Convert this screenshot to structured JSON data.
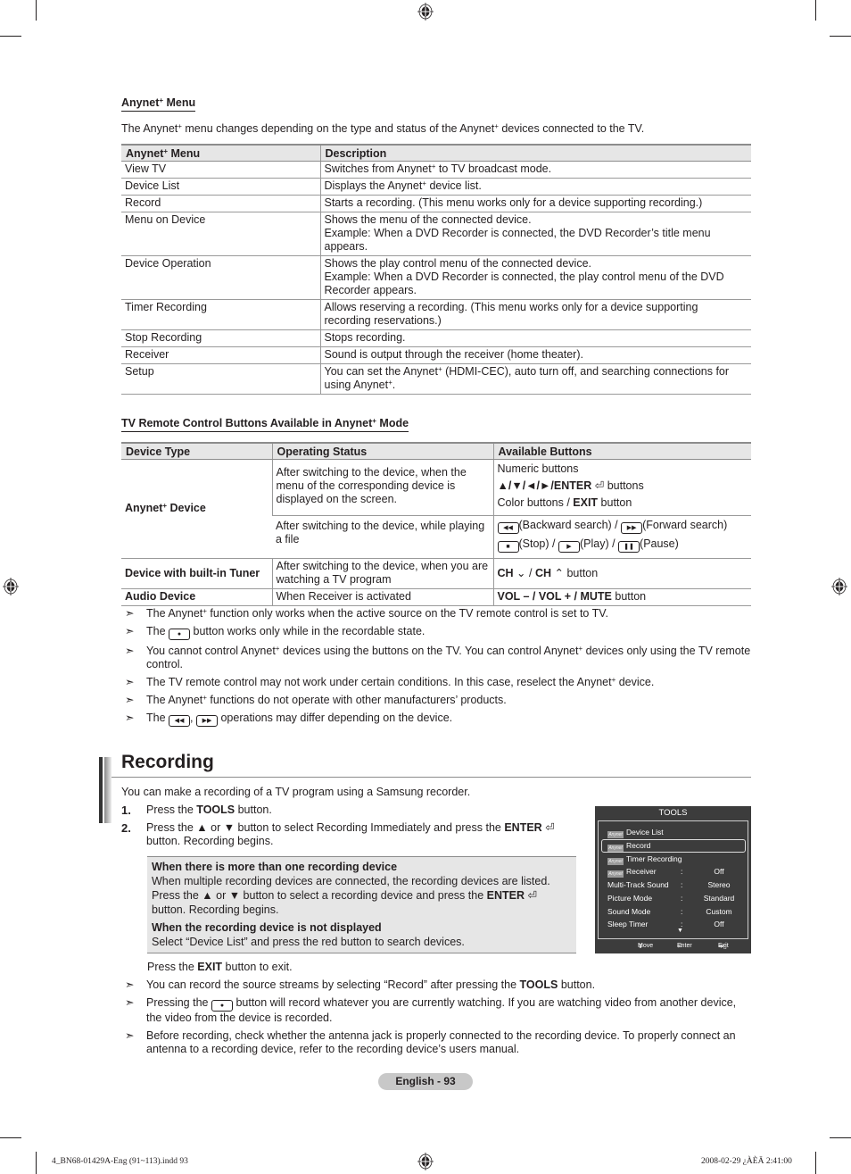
{
  "anynet_menu": {
    "heading": "Anynet",
    "heading_suffix": " Menu",
    "intro_a": "The Anynet",
    "intro_b": " menu changes depending on the type and status of the Anynet",
    "intro_c": " devices connected to the TV.",
    "plus": "+",
    "columns": [
      "Anynet+ Menu",
      "Description"
    ],
    "rows": [
      {
        "menu": "View TV",
        "desc": "Switches from Anynet+ to TV broadcast mode."
      },
      {
        "menu": "Device List",
        "desc": "Displays the Anynet+ device list."
      },
      {
        "menu": "Record",
        "desc": "Starts a recording. (This menu works only for a device supporting recording.)"
      },
      {
        "menu": "Menu on Device",
        "desc": "Shows the menu of the connected device.",
        "desc2": "Example: When a DVD Recorder is connected, the DVD Recorder’s title menu appears."
      },
      {
        "menu": "Device Operation",
        "desc": "Shows the play control menu of the connected device.",
        "desc2": "Example: When a DVD Recorder is connected, the play control menu of the DVD Recorder appears."
      },
      {
        "menu": "Timer Recording",
        "desc": "Allows reserving a recording. (This menu works only for a device supporting recording reservations.)"
      },
      {
        "menu": "Stop Recording",
        "desc": "Stops recording."
      },
      {
        "menu": "Receiver",
        "desc": "Sound is output through the receiver (home theater)."
      },
      {
        "menu": "Setup",
        "desc": "You can set the Anynet+ (HDMI-CEC), auto turn off, and searching connections for using Anynet+."
      }
    ]
  },
  "remote_table": {
    "heading": "TV Remote Control Buttons Available in Anynet+ Mode",
    "columns": [
      "Device Type",
      "Operating Status",
      "Available Buttons"
    ],
    "anynet_device": "Anynet+ Device",
    "status_menu": "After switching to the device, when the menu of the corresponding device is displayed on the screen.",
    "btn_numeric": "Numeric buttons",
    "btn_arrows": "▲/▼/◄/►/ENTER",
    "btn_arrows_suffix": " buttons",
    "btn_color": "Color buttons / ",
    "btn_exit": "EXIT",
    "btn_exit_suffix": " button",
    "status_play": "After switching to the device, while playing a file",
    "btn_backward": "(Backward search) / ",
    "btn_forward": "(Forward search)",
    "btn_stop": "(Stop) / ",
    "btn_play": "(Play) / ",
    "btn_pause": "(Pause)",
    "tuner_device": "Device with built-in Tuner",
    "status_tuner": "After switching to the device, when you are watching a TV program",
    "btn_ch": "CH",
    "btn_ch_suffix": " button",
    "audio_device": "Audio Device",
    "status_audio": "When Receiver is activated",
    "btn_vol": "VOL – / VOL + / MUTE",
    "btn_vol_suffix": " button"
  },
  "notes_anynet": [
    "The Anynet+ function only works when the active source on the TV remote control is set to TV.",
    "button works only while in the recordable state.",
    "You cannot control Anynet+ devices using the buttons on the TV. You can control Anynet+ devices only using the TV remote control.",
    "The TV remote control may not work under certain conditions. In this case, reselect the Anynet+ device.",
    "The Anynet+ functions do not operate with other manufacturers’ products.",
    "operations may differ depending on the device."
  ],
  "note_the": "The",
  "recording": {
    "title": "Recording",
    "intro": "You can make a recording of a TV program using a Samsung recorder.",
    "step1_num": "1.",
    "step1_a": "Press the ",
    "step1_b": "TOOLS",
    "step1_c": " button.",
    "step2_num": "2.",
    "step2_a": "Press the ▲ or ▼ button to select Recording Immediately and press the ",
    "step2_b": "ENTER",
    "step2_c": " button. Recording begins.",
    "box_h1": "When there is more than one recording device",
    "box_p1a": "When multiple recording devices are connected, the recording devices are listed. Press the ▲ or ▼ button to select a recording device and press the ",
    "box_p1b": "ENTER",
    "box_p1c": " button. Recording begins.",
    "box_h2": "When the recording device is not displayed",
    "box_p2": "Select “Device List” and press the red button to search devices.",
    "exit_a": "Press the ",
    "exit_b": "EXIT",
    "exit_c": " button to exit.",
    "notes": [
      {
        "a": "You can record the source streams by selecting “Record” after pressing the ",
        "b": "TOOLS",
        "c": " button."
      },
      {
        "a": "Pressing the ",
        "c": " button will record whatever you are currently watching. If you are watching video from another device, the video from the device is recorded."
      },
      {
        "a": "Before recording, check whether the antenna jack is properly connected to the recording device. To properly connect an antenna to a recording device, refer to the recording device’s users manual."
      }
    ]
  },
  "tools_osd": {
    "title": "TOOLS",
    "logo_text": "Anynet",
    "items": [
      {
        "label": "Device List",
        "anynet": true
      },
      {
        "label": "Record",
        "anynet": true,
        "selected": true
      },
      {
        "label": "Timer Recording",
        "anynet": true
      },
      {
        "label": "Receiver",
        "anynet": true,
        "value": "Off"
      },
      {
        "label": "Multi-Track Sound",
        "value": "Stereo"
      },
      {
        "label": "Picture Mode",
        "value": "Standard"
      },
      {
        "label": "Sound Mode",
        "value": "Custom"
      },
      {
        "label": "Sleep Timer",
        "value": "Off"
      }
    ],
    "colon": ":",
    "footer_move": "Move",
    "footer_enter": "Enter",
    "footer_exit": "Exit"
  },
  "footer": {
    "page_label": "English - 93",
    "slug_left": "4_BN68-01429A-Eng (91~113).indd   93",
    "slug_right": "2008-02-29   ¿ÀÈÄ 2:41:00"
  },
  "note_arrow": "➣"
}
